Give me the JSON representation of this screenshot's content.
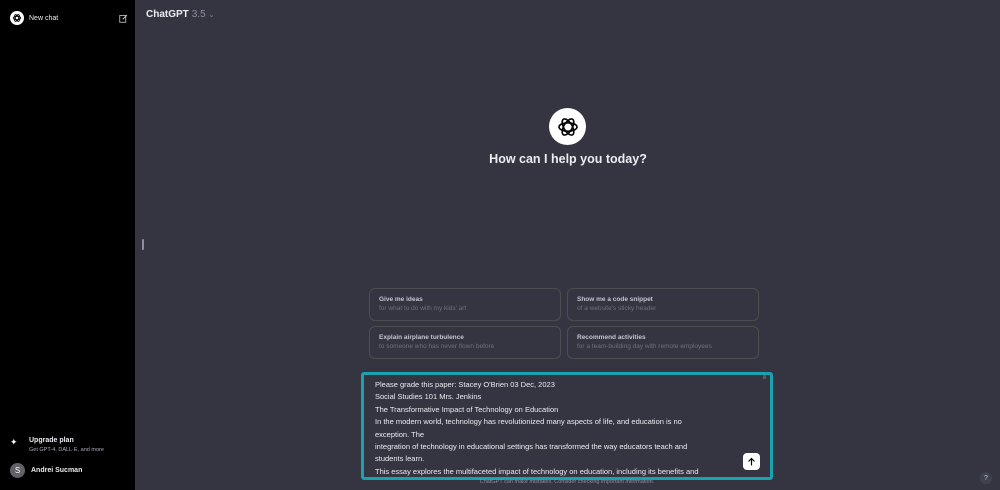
{
  "sidebar": {
    "new_chat": "New chat",
    "upgrade": {
      "title": "Upgrade plan",
      "subtitle": "Get GPT-4, DALL·E, and more"
    },
    "user": {
      "initial": "S",
      "name": "Andrei Sucman"
    }
  },
  "header": {
    "model_name": "ChatGPT",
    "model_version": "3.5",
    "chevron": "⌄"
  },
  "main": {
    "headline": "How can I help you today?",
    "suggestions": [
      {
        "title": "Give me ideas",
        "subtitle": "for what to do with my kids' art"
      },
      {
        "title": "Show me a code snippet",
        "subtitle": "of a website's sticky header"
      },
      {
        "title": "Explain airplane turbulence",
        "subtitle": "to someone who has never flown before"
      },
      {
        "title": "Recommend activities",
        "subtitle": "for a team-building day with remote employees"
      }
    ]
  },
  "composer": {
    "lines": [
      "Please grade this paper:  Stacey O'Brien 03 Dec, 2023",
      "Social Studies 101 Mrs. Jenkins",
      "The Transformative Impact of Technology on Education",
      "In the modern world, technology has revolutionized many aspects of life, and education is no",
      "exception. The",
      "integration of technology in educational settings has transformed the way educators teach and",
      "students learn.",
      "This essay explores the multifaceted impact of technology on education, including its benefits and"
    ]
  },
  "footer": {
    "disclaimer": "ChatGPT can make mistakes. Consider checking important information.",
    "help": "?"
  },
  "colors": {
    "background": "#343541",
    "sidebar": "#000000",
    "focus_ring": "#1ba2b0"
  }
}
